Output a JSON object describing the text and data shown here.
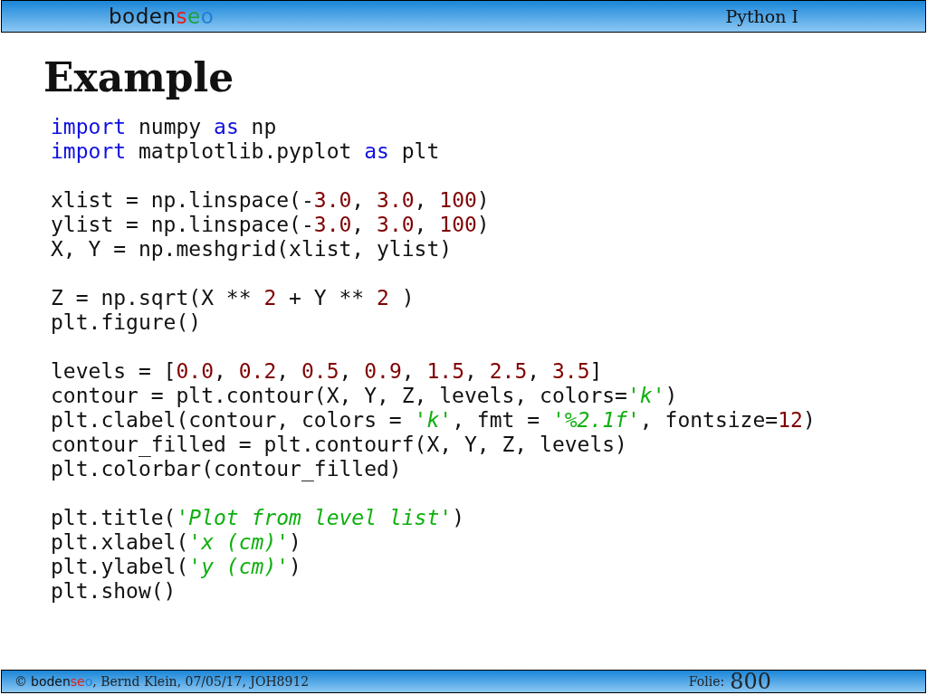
{
  "header": {
    "logo": [
      {
        "text": "boden",
        "color": "#111111"
      },
      {
        "text": "s",
        "color": "#e02020"
      },
      {
        "text": "e",
        "color": "#20a040"
      },
      {
        "text": "o",
        "color": "#2080d0"
      }
    ],
    "course": "Python I"
  },
  "slide": {
    "title": "Example",
    "code_blocks": [
      [
        [
          {
            "kind": "keyword",
            "text": "import"
          },
          {
            "kind": "plain",
            "text": " numpy "
          },
          {
            "kind": "keyword",
            "text": "as"
          },
          {
            "kind": "plain",
            "text": " np"
          }
        ],
        [
          {
            "kind": "keyword",
            "text": "import"
          },
          {
            "kind": "plain",
            "text": " matplotlib.pyplot "
          },
          {
            "kind": "keyword",
            "text": "as"
          },
          {
            "kind": "plain",
            "text": " plt"
          }
        ]
      ],
      [
        [
          {
            "kind": "plain",
            "text": "xlist = np.linspace(-"
          },
          {
            "kind": "number",
            "text": "3.0"
          },
          {
            "kind": "plain",
            "text": ", "
          },
          {
            "kind": "number",
            "text": "3.0"
          },
          {
            "kind": "plain",
            "text": ", "
          },
          {
            "kind": "number",
            "text": "100"
          },
          {
            "kind": "plain",
            "text": ")"
          }
        ],
        [
          {
            "kind": "plain",
            "text": "ylist = np.linspace(-"
          },
          {
            "kind": "number",
            "text": "3.0"
          },
          {
            "kind": "plain",
            "text": ", "
          },
          {
            "kind": "number",
            "text": "3.0"
          },
          {
            "kind": "plain",
            "text": ", "
          },
          {
            "kind": "number",
            "text": "100"
          },
          {
            "kind": "plain",
            "text": ")"
          }
        ],
        [
          {
            "kind": "plain",
            "text": "X, Y = np.meshgrid(xlist, ylist)"
          }
        ]
      ],
      [
        [
          {
            "kind": "plain",
            "text": "Z = np.sqrt(X ** "
          },
          {
            "kind": "number",
            "text": "2"
          },
          {
            "kind": "plain",
            "text": " + Y ** "
          },
          {
            "kind": "number",
            "text": "2"
          },
          {
            "kind": "plain",
            "text": " )"
          }
        ],
        [
          {
            "kind": "plain",
            "text": "plt.figure()"
          }
        ]
      ],
      [
        [
          {
            "kind": "plain",
            "text": "levels = ["
          },
          {
            "kind": "number",
            "text": "0.0"
          },
          {
            "kind": "plain",
            "text": ", "
          },
          {
            "kind": "number",
            "text": "0.2"
          },
          {
            "kind": "plain",
            "text": ", "
          },
          {
            "kind": "number",
            "text": "0.5"
          },
          {
            "kind": "plain",
            "text": ", "
          },
          {
            "kind": "number",
            "text": "0.9"
          },
          {
            "kind": "plain",
            "text": ", "
          },
          {
            "kind": "number",
            "text": "1.5"
          },
          {
            "kind": "plain",
            "text": ", "
          },
          {
            "kind": "number",
            "text": "2.5"
          },
          {
            "kind": "plain",
            "text": ", "
          },
          {
            "kind": "number",
            "text": "3.5"
          },
          {
            "kind": "plain",
            "text": "]"
          }
        ],
        [
          {
            "kind": "plain",
            "text": "contour = plt.contour(X, Y, Z, levels, colors="
          },
          {
            "kind": "string",
            "text": "'k'"
          },
          {
            "kind": "plain",
            "text": ")"
          }
        ],
        [
          {
            "kind": "plain",
            "text": "plt.clabel(contour, colors = "
          },
          {
            "kind": "string",
            "text": "'k'"
          },
          {
            "kind": "plain",
            "text": ", fmt = "
          },
          {
            "kind": "string",
            "text": "'%2.1f'"
          },
          {
            "kind": "plain",
            "text": ", fontsize="
          },
          {
            "kind": "number",
            "text": "12"
          },
          {
            "kind": "plain",
            "text": ")"
          }
        ],
        [
          {
            "kind": "plain",
            "text": "contour_filled = plt.contourf(X, Y, Z, levels)"
          }
        ],
        [
          {
            "kind": "plain",
            "text": "plt.colorbar(contour_filled)"
          }
        ]
      ],
      [
        [
          {
            "kind": "plain",
            "text": "plt.title("
          },
          {
            "kind": "string",
            "text": "'Plot from level list'"
          },
          {
            "kind": "plain",
            "text": ")"
          }
        ],
        [
          {
            "kind": "plain",
            "text": "plt.xlabel("
          },
          {
            "kind": "string",
            "text": "'x (cm)'"
          },
          {
            "kind": "plain",
            "text": ")"
          }
        ],
        [
          {
            "kind": "plain",
            "text": "plt.ylabel("
          },
          {
            "kind": "string",
            "text": "'y (cm)'"
          },
          {
            "kind": "plain",
            "text": ")"
          }
        ],
        [
          {
            "kind": "plain",
            "text": "plt.show()"
          }
        ]
      ]
    ]
  },
  "footer": {
    "copyright": "©",
    "logo": [
      {
        "text": "boden",
        "color": "#111111"
      },
      {
        "text": "se",
        "color": "#e02020"
      },
      {
        "text": "o",
        "color": "#2080d0"
      }
    ],
    "credits": ", Bernd Klein, 07/05/17, JOH8912",
    "slide_label": "Folie:",
    "slide_number": "800"
  }
}
